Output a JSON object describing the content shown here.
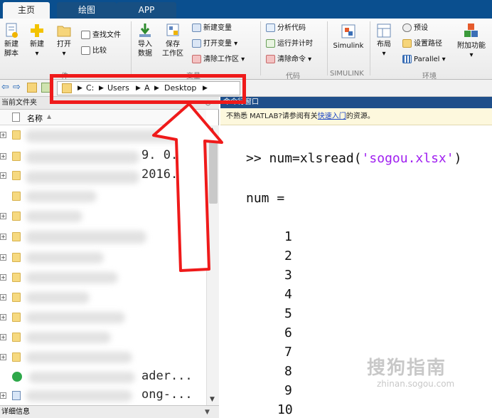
{
  "tabs": [
    "主页",
    "绘图",
    "APP"
  ],
  "ribbon": {
    "file_group": {
      "new_script": [
        "新建",
        "脚本"
      ],
      "new": "新建",
      "open": "打开",
      "find_files": "查找文件",
      "compare": "比较"
    },
    "variable_group": {
      "import_data": [
        "导入",
        "数据"
      ],
      "save_workspace": [
        "保存",
        "工作区"
      ],
      "new_variable": "新建变量",
      "open_variable": "打开变量",
      "clear_workspace": "清除工作区",
      "label_fragment": "变量"
    },
    "code_group": {
      "analyze_code": "分析代码",
      "run_and_time": "运行并计时",
      "clear_commands": "清除命令",
      "label": "代码"
    },
    "simulink_group": {
      "simulink": "Simulink",
      "label": "SIMULINK"
    },
    "env_group": {
      "layout": "布局",
      "preferences": "预设",
      "set_path": "设置路径",
      "parallel": "Parallel",
      "addons": "附加功能",
      "label": "环境"
    }
  },
  "address_bar": {
    "segments": [
      "C:",
      "Users",
      "A",
      "Desktop"
    ]
  },
  "current_folder": {
    "title": "当前文件夹",
    "column_name": "名称",
    "visible_fragments": [
      "9. 0. . .",
      "2016. . .",
      "ader...",
      "ong-..."
    ],
    "footer": "详细信息"
  },
  "command_window": {
    "title": "命令行窗口",
    "notice_prefix": "不熟悉 MATLAB?请参阅有关",
    "notice_link": "快速入门",
    "notice_suffix": "的资源。",
    "prompt": ">> ",
    "command_pre": "num=xlsread(",
    "command_arg": "'sogou.xlsx'",
    "command_post": ")",
    "output_var": "num =",
    "output_values": [
      "1",
      "2",
      "3",
      "4",
      "5",
      "6",
      "7",
      "8",
      "9",
      "10"
    ]
  },
  "watermark": {
    "text": "搜狗指南",
    "url": "zhinan.sogou.com"
  },
  "colors": {
    "tab_bar": "#0a4f8f",
    "annotation": "#ef1a1a",
    "string_literal": "#a020f0"
  }
}
